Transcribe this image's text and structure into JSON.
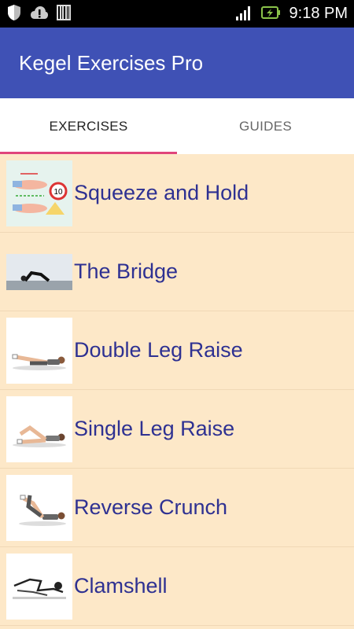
{
  "status_bar": {
    "time": "9:18 PM",
    "icons": [
      "shield-icon",
      "cloud-alert-icon",
      "barcode-icon",
      "signal-icon",
      "battery-charging-icon"
    ]
  },
  "app_bar": {
    "title": "Kegel Exercises Pro"
  },
  "tabs": [
    {
      "label": "EXERCISES",
      "active": true
    },
    {
      "label": "GUIDES",
      "active": false
    }
  ],
  "exercises": [
    {
      "name": "Squeeze and Hold",
      "thumb_badge": "10"
    },
    {
      "name": "The Bridge"
    },
    {
      "name": "Double Leg Raise"
    },
    {
      "name": "Single Leg Raise"
    },
    {
      "name": "Reverse Crunch"
    },
    {
      "name": "Clamshell"
    }
  ],
  "colors": {
    "app_bar": "#3f51b5",
    "tab_indicator": "#e0457b",
    "list_background": "#fde8c8",
    "item_text": "#2e3192"
  }
}
